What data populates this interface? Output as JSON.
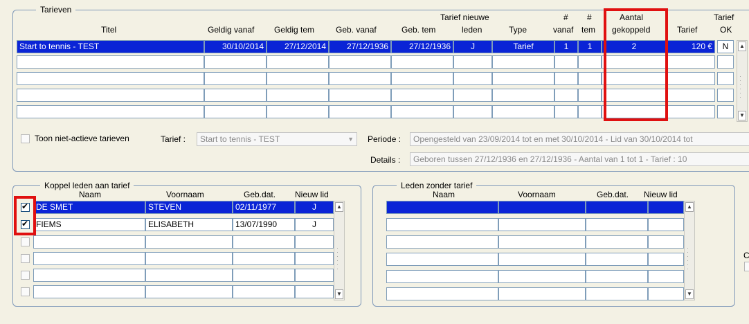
{
  "tarieven": {
    "legend": "Tarieven",
    "headers": {
      "titel": "Titel",
      "geldig_vanaf": "Geldig vanaf",
      "geldig_tem": "Geldig tem",
      "geb_vanaf": "Geb. vanaf",
      "geb_tem": "Geb. tem",
      "nieuwe_leden_top": "Tarief nieuwe",
      "nieuwe_leden_bottom": "leden",
      "type": "Type",
      "nr_vanaf_top": "#",
      "nr_vanaf_bottom": "vanaf",
      "nr_tem_top": "#",
      "nr_tem_bottom": "tem",
      "aantal_top": "Aantal",
      "aantal_bottom": "gekoppeld",
      "tarief": "Tarief",
      "tarief_ok_top": "Tarief",
      "tarief_ok_bottom": "OK"
    },
    "rows": [
      {
        "titel": "Start to tennis - TEST",
        "geldig_vanaf": "30/10/2014",
        "geldig_tem": "27/12/2014",
        "geb_vanaf": "27/12/1936",
        "geb_tem": "27/12/1936",
        "nieuwe_leden": "J",
        "type": "Tarief",
        "nr_vanaf": "1",
        "nr_tem": "1",
        "aantal": "2",
        "tarief": "120 €",
        "ok": "N"
      }
    ],
    "empty_rows": 4,
    "toon_label": "Toon niet-actieve tarieven",
    "tarief_label": "Tarief :",
    "tarief_value": "Start to tennis - TEST",
    "periode_label": "Periode :",
    "periode_value": "Opengesteld van 23/09/2014 tot en met 30/10/2014 - Lid van 30/10/2014 tot",
    "details_label": "Details :",
    "details_value": "Geboren tussen 27/12/1936 en 27/12/1936 - Aantal van 1 tot 1 - Tarief : 10"
  },
  "koppel": {
    "legend": "Koppel leden aan tarief",
    "headers": {
      "naam": "Naam",
      "voornaam": "Voornaam",
      "gebdat": "Geb.dat.",
      "nieuw": "Nieuw lid"
    },
    "rows": [
      {
        "checked": true,
        "naam": "DE SMET",
        "voornaam": "STEVEN",
        "gebdat": "02/11/1977",
        "nieuw": "J"
      },
      {
        "checked": true,
        "naam": "FIEMS",
        "voornaam": "ELISABETH",
        "gebdat": "13/07/1990",
        "nieuw": "J"
      }
    ],
    "empty_rows": 4
  },
  "zonder": {
    "legend": "Leden zonder tarief",
    "headers": {
      "naam": "Naam",
      "voornaam": "Voornaam",
      "gebdat": "Geb.dat.",
      "nieuw": "Nieuw lid"
    },
    "empty_rows": 6
  },
  "colors": {
    "selection": "#0a24d6",
    "highlight": "#e01010",
    "background": "#f3f1e4"
  }
}
